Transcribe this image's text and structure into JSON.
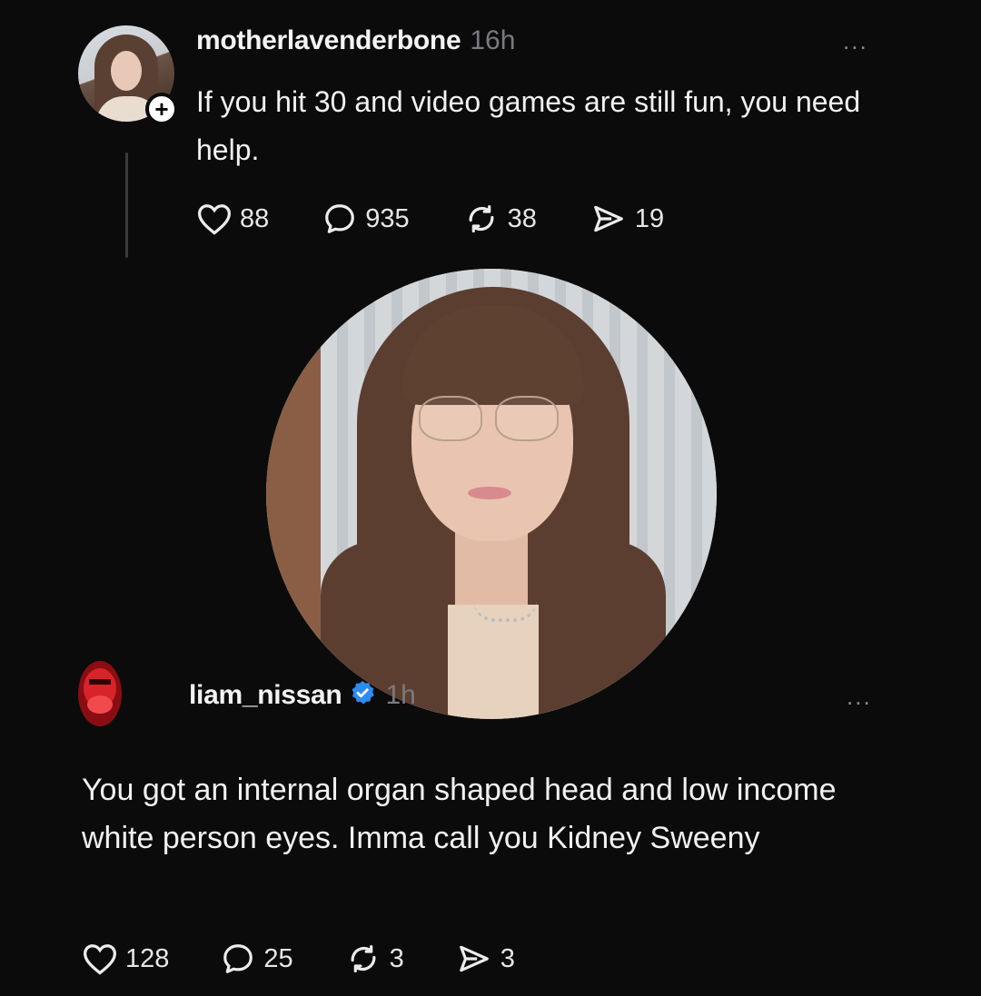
{
  "post1": {
    "username": "motherlavenderbone",
    "time": "16h",
    "text": "If you hit 30 and video games are still fun, you need help.",
    "more": "...",
    "follow_symbol": "+",
    "likes": "88",
    "comments": "935",
    "reposts": "38",
    "shares": "19"
  },
  "post2": {
    "username": "liam_nissan",
    "time": "1h",
    "text": "You got an internal organ shaped head and low income white person eyes. Imma call you Kidney Sweeny",
    "more": "...",
    "likes": "128",
    "comments": "25",
    "reposts": "3",
    "shares": "3"
  },
  "icons": {
    "like": "heart-icon",
    "comment": "comment-bubble-icon",
    "repost": "repost-icon",
    "share": "send-icon",
    "verified": "verified-badge-icon"
  },
  "colors": {
    "background": "#0b0b0c",
    "text": "#f3f3f3",
    "muted": "#7a7a7e",
    "verified": "#2d8cf0"
  }
}
